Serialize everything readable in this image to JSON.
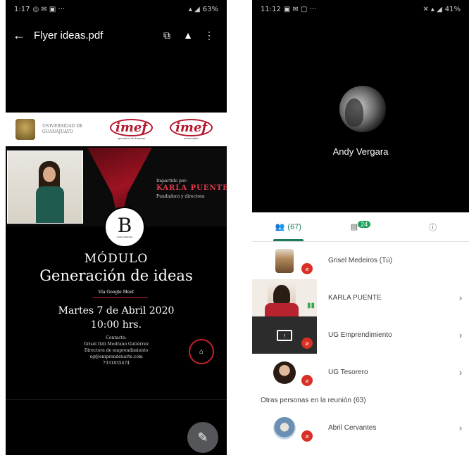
{
  "left": {
    "status_time": "1:17",
    "status_battery": "63%",
    "title": "Flyer ideas.pdf",
    "flyer": {
      "university": "UNIVERSIDAD DE GUANAJUATO",
      "imef_1": "imef",
      "imef_1_sub": "ejecutivos de finanzas",
      "imef_2": "imef",
      "imef_2_sub": "universitario",
      "impartido": "Impartido por:",
      "karla": "KARLA PUENTE",
      "fundadora": "Fundadora y directora",
      "b_letter": "B",
      "b_text": "KARLA BRIDGE",
      "modulo": "MÓDULO",
      "generacion": "Generación de ideas",
      "via": "Vía Google Meet",
      "fecha": "Martes 7 de Abril 2020",
      "hora": "10:00 hrs.",
      "contacto": "Contacto:",
      "contacto_nombre": "Grisel Itzli Medrano Gutiérrez",
      "contacto_cargo": "Directora de emprendimiento",
      "contacto_mail": "ug@emprendeuarte.com",
      "contacto_tel": "7331835474"
    }
  },
  "right": {
    "status_time": "11:12",
    "status_battery": "41%",
    "speaker_name": "Andy Vergara",
    "tabs": [
      {
        "label": "(67)"
      },
      {
        "badge": "24"
      },
      {
        "label": "ⓘ"
      }
    ],
    "participants": [
      {
        "name": "Grisel Medeiros (Tú)"
      },
      {
        "name": "KARLA PUENTE"
      },
      {
        "name": "UG Emprendimiento"
      },
      {
        "name": "UG Tesorero"
      }
    ],
    "others_label": "Otras personas en la reunión (63)",
    "others": [
      {
        "name": "Abril Cervantes"
      }
    ]
  }
}
